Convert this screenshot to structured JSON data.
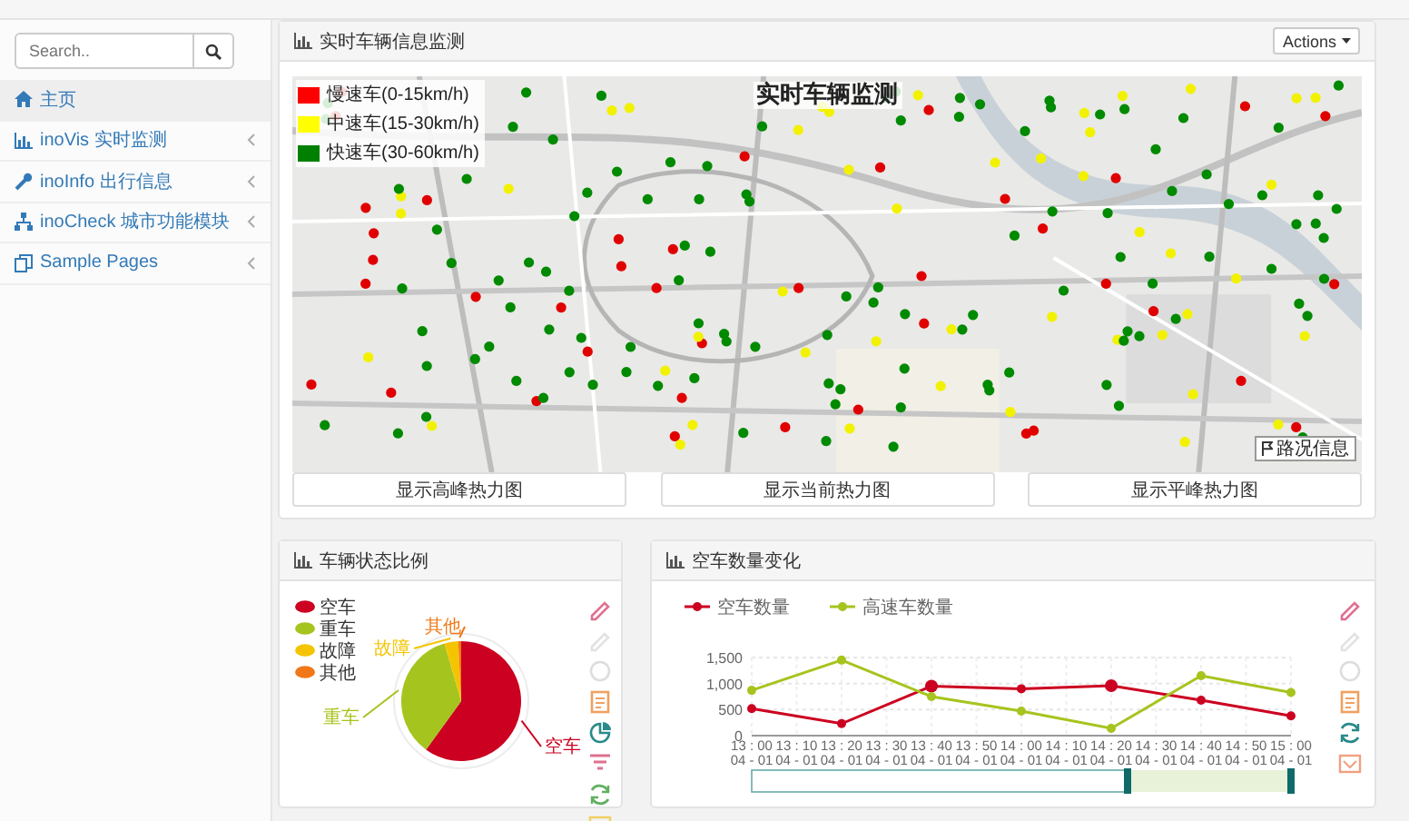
{
  "sidebar": {
    "search": {
      "placeholder": "Search.."
    },
    "items": [
      {
        "label": "主页",
        "selected": true,
        "has_submenu": false
      },
      {
        "label": "inoVis 实时监测",
        "selected": false,
        "has_submenu": true
      },
      {
        "label": "inoInfo 出行信息",
        "selected": false,
        "has_submenu": true
      },
      {
        "label": "inoCheck 城市功能模块",
        "selected": false,
        "has_submenu": true
      },
      {
        "label": "Sample Pages",
        "selected": false,
        "has_submenu": true
      }
    ]
  },
  "map_panel": {
    "title": "实时车辆信息监测",
    "actions_button": "Actions",
    "map": {
      "kind": "picture",
      "title": "实时车辆监测",
      "traffic_button": "路况信息",
      "legend": [
        {
          "label": "慢速车(0-15km/h)",
          "color": "#ff0000"
        },
        {
          "label": "中速车(15-30km/h)",
          "color": "#ffff00"
        },
        {
          "label": "快速车(30-60km/h)",
          "color": "#008000"
        }
      ]
    },
    "buttons": [
      "显示高峰热力图",
      "显示当前热力图",
      "显示平峰热力图"
    ]
  },
  "pie_panel": {
    "title": "车辆状态比例",
    "legend": [
      {
        "label": "空车",
        "color": "#cc0020"
      },
      {
        "label": "重车",
        "color": "#a6c41e"
      },
      {
        "label": "故障",
        "color": "#f5c400"
      },
      {
        "label": "其他",
        "color": "#f07818"
      }
    ],
    "slice_labels": [
      "空车",
      "重车",
      "故障",
      "其他"
    ]
  },
  "line_panel": {
    "title": "空车数量变化",
    "chart_data": {
      "type": "line",
      "categories": [
        "13 : 00\n04 - 01",
        "13 : 10\n04 - 01",
        "13 : 20\n04 - 01",
        "13 : 30\n04 - 01",
        "13 : 40\n04 - 01",
        "13 : 50\n04 - 01",
        "14 : 00\n04 - 01",
        "14 : 10\n04 - 01",
        "14 : 20\n04 - 01",
        "14 : 30\n04 - 01",
        "14 : 40\n04 - 01",
        "14 : 50\n04 - 01",
        "15 : 00\n04 - 01"
      ],
      "series": [
        {
          "name": "空车数量",
          "color": "#cc0020",
          "marker": "circle",
          "values": [
            520,
            null,
            230,
            null,
            950,
            null,
            900,
            null,
            960,
            null,
            680,
            null,
            380
          ]
        },
        {
          "name": "高速车数量",
          "color": "#a6c41e",
          "marker": "circle",
          "values": [
            870,
            null,
            1450,
            null,
            750,
            null,
            470,
            null,
            140,
            null,
            1150,
            null,
            830
          ]
        }
      ],
      "ylim": [
        0,
        1500
      ],
      "grid": true,
      "legend": "top",
      "yticks": [
        0,
        500,
        {
          "value": 1000,
          "label": "1,000"
        },
        {
          "value": 1500,
          "label": "1,500"
        }
      ]
    }
  }
}
